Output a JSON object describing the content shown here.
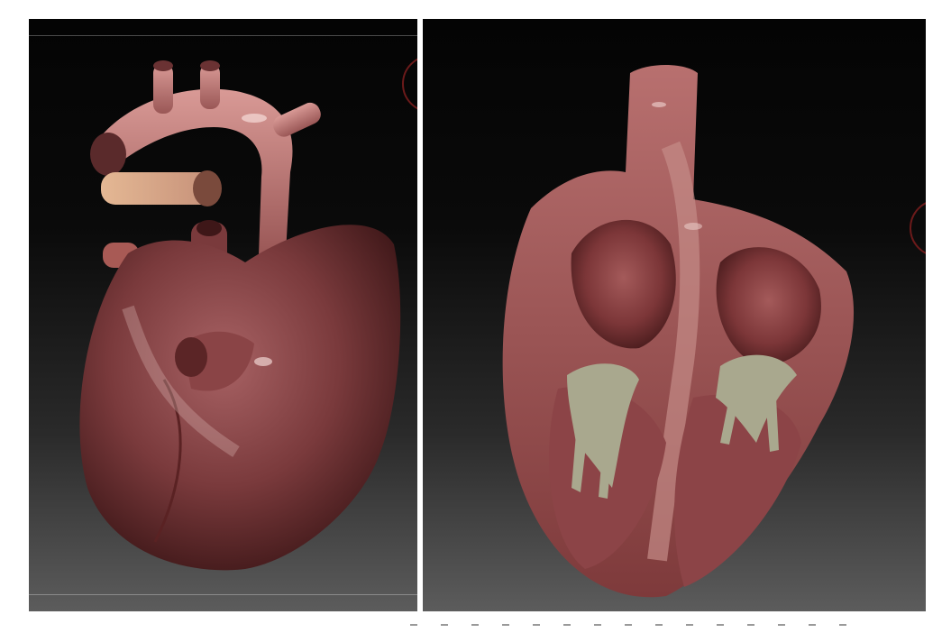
{
  "viewports": [
    {
      "id": "left",
      "view": "external"
    },
    {
      "id": "right",
      "view": "cross-section"
    }
  ],
  "colors": {
    "background": "#ffffff",
    "viewport_top": "#040404",
    "viewport_bottom": "#5c5c5c",
    "muscle": "#7a3a3c",
    "vessel": "#b9706e",
    "valve": "#a9a88e",
    "edge_ring": "#6b1a1a"
  }
}
